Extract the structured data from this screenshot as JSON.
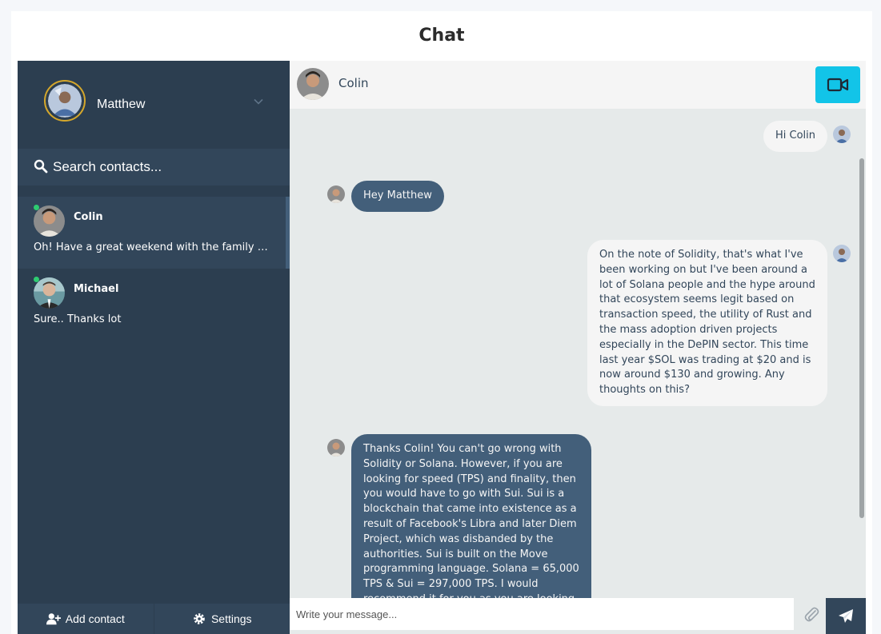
{
  "page": {
    "title": "Chat"
  },
  "profile": {
    "name": "Matthew"
  },
  "search": {
    "placeholder": "Search contacts..."
  },
  "contacts": [
    {
      "name": "Colin",
      "preview": "Oh! Have a great weekend with the family a...",
      "online": true,
      "active": true
    },
    {
      "name": "Michael",
      "preview": "Sure.. Thanks lot",
      "online": true,
      "active": false
    }
  ],
  "bottom": {
    "add_contact": "Add contact",
    "settings": "Settings"
  },
  "header": {
    "contact_name": "Colin"
  },
  "messages": [
    {
      "type": "sent",
      "text": "Hi Colin"
    },
    {
      "type": "received",
      "text": "Hey Matthew"
    },
    {
      "type": "sent",
      "text": "On the note of Solidity, that's what I've been working on but I've been around a lot of Solana people and the hype around that ecosystem seems legit based on transaction speed, the utility of Rust and the mass adoption driven projects especially in the DePIN sector. This time last year $SOL was trading at $20 and is now around $130 and growing. Any thoughts on this?"
    },
    {
      "type": "received",
      "text": "Thanks Colin! You can't go wrong with Solidity or Solana. However, if you are looking for speed (TPS) and finality, then you would have to go with Sui. Sui is a blockchain that came into existence as a result of Facebook's Libra and later Diem Project, which was disbanded by the authorities. Sui is built on the Move programming language. Solana = 65,000 TPS & Sui = 297,000 TPS. I would recommend it for you as you are looking to build..."
    }
  ],
  "composer": {
    "placeholder": "Write your message..."
  },
  "colors": {
    "sidebar": "#2c3e50",
    "sidebar_alt": "#32465a",
    "received_bubble": "#435f7a",
    "sent_bubble": "#f5f5f5",
    "chat_bg": "#e6eaea",
    "video_button": "#12c4e8",
    "online": "#2ecc71",
    "avatar_ring": "#d4a72c"
  },
  "icons": {
    "search": "search-icon",
    "caret": "chevron-down-icon",
    "video": "video-camera-icon",
    "attach": "paperclip-icon",
    "send": "paper-plane-icon",
    "add_user": "user-plus-icon",
    "settings": "gear-icon"
  }
}
